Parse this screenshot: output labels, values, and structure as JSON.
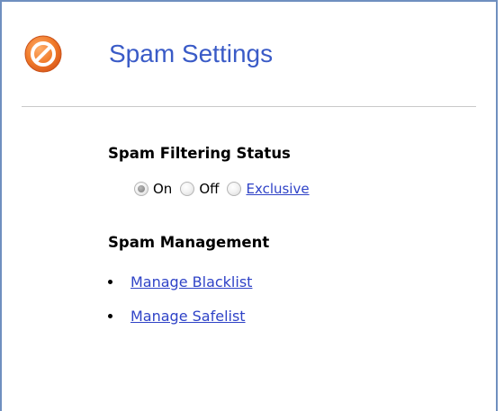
{
  "header": {
    "title": "Spam Settings",
    "icon": "prohibited-icon",
    "icon_color": "#e8651c"
  },
  "filtering": {
    "heading": "Spam Filtering Status",
    "options": [
      {
        "label": "On",
        "selected": true,
        "link": false
      },
      {
        "label": "Off",
        "selected": false,
        "link": false
      },
      {
        "label": "Exclusive",
        "selected": false,
        "link": true
      }
    ]
  },
  "management": {
    "heading": "Spam Management",
    "links": [
      {
        "label": "Manage Blacklist"
      },
      {
        "label": "Manage Safelist"
      }
    ]
  },
  "colors": {
    "title": "#3a5bc7",
    "link": "#2f43c7",
    "border": "#6f8fbf"
  }
}
